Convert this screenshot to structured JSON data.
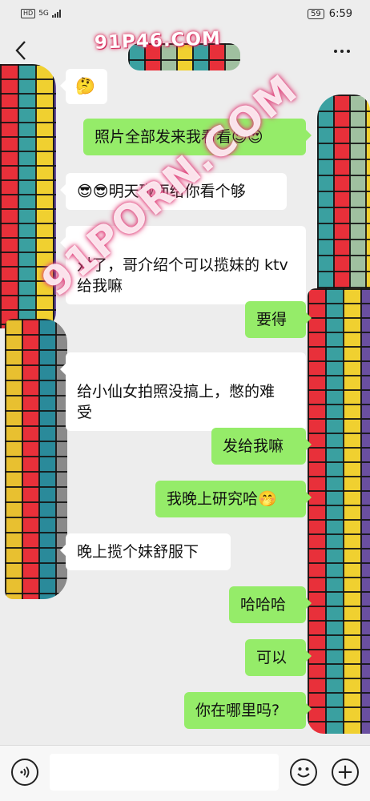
{
  "status_bar": {
    "network_badge": "HD",
    "network_type": "5G",
    "battery": "59",
    "time": "6:59"
  },
  "header": {
    "watermark": "91P46.COM",
    "back_icon": "chevron-left-icon",
    "more_icon": "more-dots-icon"
  },
  "watermark_diagonal": "91PORN.COM",
  "messages": [
    {
      "side": "in",
      "text": "🤔"
    },
    {
      "side": "out",
      "text": "照片全部发来我看看😍😍"
    },
    {
      "side": "in",
      "text": "😎😎明天碰面给你看个够"
    },
    {
      "side": "in",
      "text": "对了，哥介绍个可以揽妹的 ktv\n给我嘛"
    },
    {
      "side": "out",
      "text": "要得"
    },
    {
      "side": "in",
      "text": "给小仙女拍照没搞上，憋的难\n受"
    },
    {
      "side": "out",
      "text": "发给我嘛"
    },
    {
      "side": "out",
      "text": "我晚上研究哈🤭"
    },
    {
      "side": "in",
      "text": "晚上揽个妹舒服下"
    },
    {
      "side": "out",
      "text": "哈哈哈"
    },
    {
      "side": "out",
      "text": "可以"
    },
    {
      "side": "out",
      "text": "你在哪里吗?"
    }
  ],
  "input_bar": {
    "voice_icon": "voice-icon",
    "emoji_icon": "emoji-smile-icon",
    "plus_icon": "plus-icon",
    "plus_glyph": "+"
  },
  "colors": {
    "outgoing_bubble": "#95ec69",
    "incoming_bubble": "#ffffff",
    "background": "#ededed"
  }
}
